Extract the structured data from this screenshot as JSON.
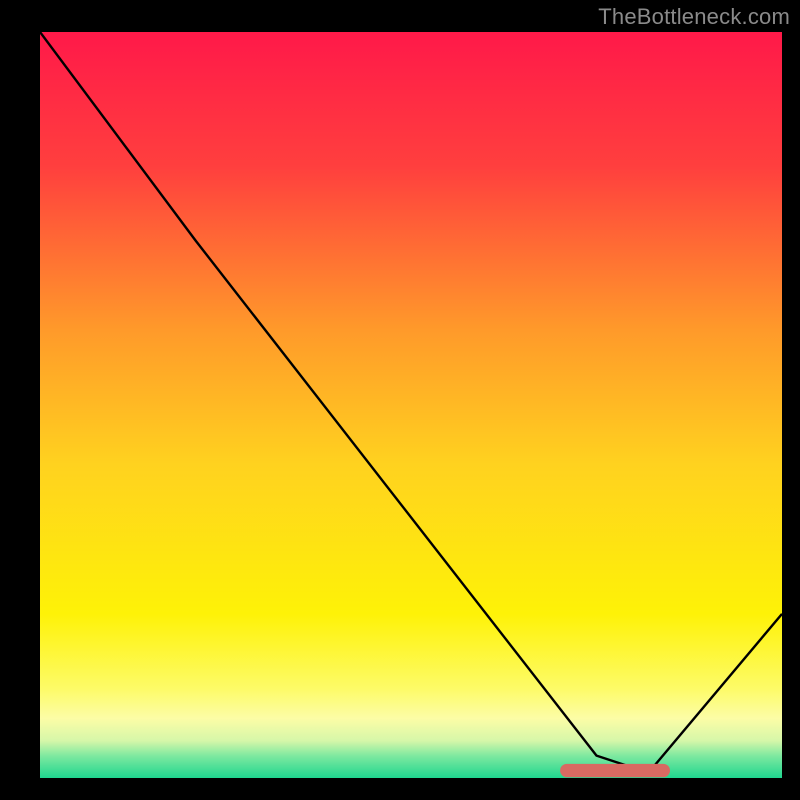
{
  "attribution": "TheBottleneck.com",
  "chart_data": {
    "type": "line",
    "title": "",
    "xlabel": "",
    "ylabel": "",
    "xlim": [
      0,
      100
    ],
    "ylim": [
      0,
      100
    ],
    "grid": false,
    "background_gradient": {
      "stops": [
        {
          "pos": 0.0,
          "color": "#ff1949"
        },
        {
          "pos": 0.18,
          "color": "#ff3f3e"
        },
        {
          "pos": 0.4,
          "color": "#ff9a2a"
        },
        {
          "pos": 0.58,
          "color": "#ffd21f"
        },
        {
          "pos": 0.78,
          "color": "#fef207"
        },
        {
          "pos": 0.88,
          "color": "#fdfb67"
        },
        {
          "pos": 0.92,
          "color": "#fcfda6"
        },
        {
          "pos": 0.95,
          "color": "#d6f7a9"
        },
        {
          "pos": 0.97,
          "color": "#7fe9a0"
        },
        {
          "pos": 1.0,
          "color": "#1fd68f"
        }
      ]
    },
    "series": [
      {
        "name": "curve",
        "color": "#000000",
        "width": 2.4,
        "points": [
          {
            "x": 0.0,
            "y": 100.0
          },
          {
            "x": 21.0,
            "y": 72.0
          },
          {
            "x": 75.0,
            "y": 3.0
          },
          {
            "x": 82.0,
            "y": 0.7
          },
          {
            "x": 100.0,
            "y": 22.0
          }
        ]
      }
    ],
    "highlight_band": {
      "color": "#d86a62",
      "y": 1.0,
      "x0": 71.0,
      "x1": 84.0,
      "thickness": 1.8
    }
  }
}
